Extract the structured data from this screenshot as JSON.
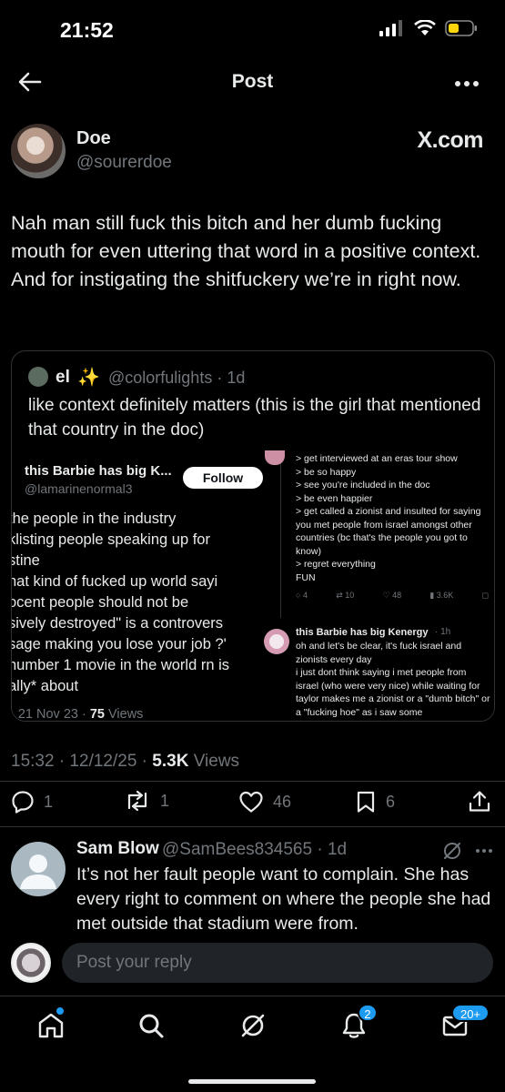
{
  "status_bar": {
    "time": "21:52"
  },
  "header": {
    "title": "Post"
  },
  "post": {
    "author_name": "Doe",
    "author_handle": "@sourerdoe",
    "watermark": "X.com",
    "text": "Nah man still fuck this bitch and her dumb fucking mouth for even uttering that word in a positive context. And for instigating the shitfuckery we’re in right now.",
    "timestamp": "15:32 · 12/12/25 · ",
    "views_count": "5.3K",
    "views_label": " Views"
  },
  "quote": {
    "name": "el",
    "sparkle": "✨",
    "handle": "@colorfulights · 1d",
    "text": "like context definitely matters (this is the girl that mentioned that country in the doc)",
    "media": {
      "left": {
        "name": "this Barbie has big K...",
        "handle": "@lamarinenormal3",
        "follow_label": "Follow",
        "lines": [
          " the people in the industry",
          "klisting people speaking up for",
          "stine",
          "hat kind of fucked up world sayi",
          "ocent people should not be",
          "sively destroyed\" is a controvers",
          "sage making you lose your job ?'",
          "number 1 movie in the world rn is",
          "ally* about"
        ],
        "meta_date": "· 21 Nov 23 · ",
        "meta_views": "75",
        "meta_views_label": " Views"
      },
      "right": {
        "lines": [
          "> get interviewed at an eras tour show",
          "> be so happy",
          "> see you're included in the doc",
          "> be even happier",
          "> get called a zionist and insulted for saying you met people from israel amongst other countries (bc that's the people you got to know)",
          "> regret everything"
        ],
        "fun": "FUN",
        "actions": [
          "4",
          "10",
          "48",
          "3.6K"
        ],
        "name2": "this Barbie has big Kenergy",
        "time2": "· 1h",
        "body2": "oh and let's be clear, it's fuck israel and zionists every day\ni just dont think saying i met people from israel (who were very nice) while waiting for taylor makes me a zionist or a \"dumb bitch\" or a \"fucking hoe\" as i saw some"
      }
    }
  },
  "actions": {
    "replies": "1",
    "reposts": "1",
    "likes": "46",
    "bookmarks": "6"
  },
  "reply": {
    "name": "Sam Blow",
    "handle": "@SamBees834565 · 1d",
    "text": "It’s not her fault people want to complain. She has every right to comment on where the people she had met outside that stadium were from."
  },
  "composer": {
    "placeholder": "Post your reply"
  },
  "tabbar": {
    "notifications_badge": "2",
    "messages_badge": "20+"
  },
  "icons": [
    "back-arrow-icon",
    "more-icon",
    "reply-icon",
    "repost-icon",
    "like-icon",
    "bookmark-icon",
    "share-icon",
    "grok-icon",
    "home-icon",
    "search-icon",
    "bell-icon",
    "mail-icon"
  ],
  "colors": {
    "background": "#000000",
    "text": "#e7e9ea",
    "secondary": "#71767b",
    "accent": "#1d9bf0",
    "divider": "#2f3336"
  }
}
